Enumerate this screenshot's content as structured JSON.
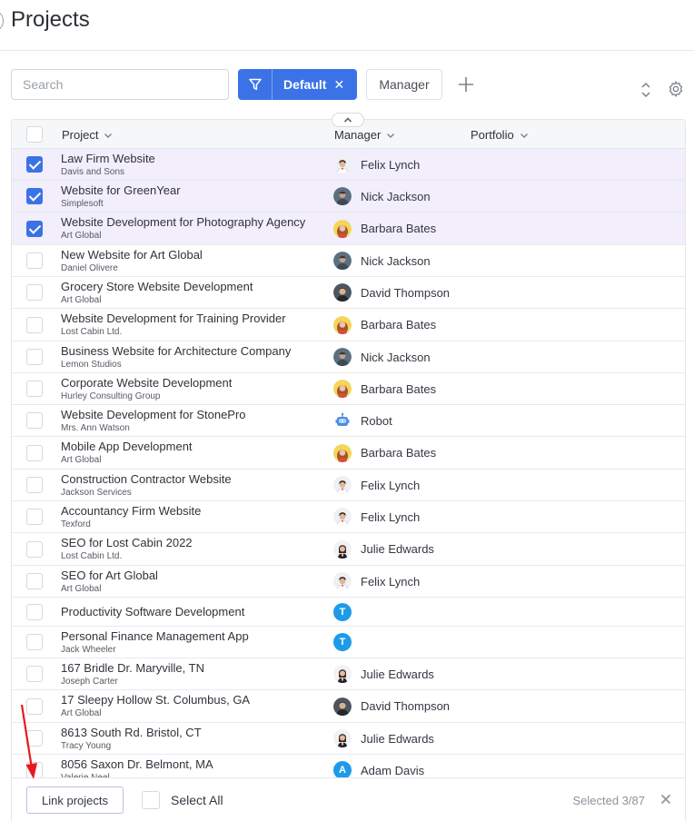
{
  "page": {
    "title": "Projects"
  },
  "toolbar": {
    "search_placeholder": "Search",
    "filter_label": "Default",
    "filter_close": "✕",
    "manager_label": "Manager",
    "add_icon": "plus-icon",
    "sort_icon": "sort-updown-icon",
    "settings_icon": "gear-icon"
  },
  "table": {
    "columns": {
      "project": "Project",
      "manager": "Manager",
      "portfolio": "Portfolio"
    },
    "rows": [
      {
        "name": "Law Firm Website",
        "client": "Davis and Sons",
        "manager": "Felix Lynch",
        "avatar": "felix",
        "checked": true
      },
      {
        "name": "Website for GreenYear",
        "client": "Simplesoft",
        "manager": "Nick Jackson",
        "avatar": "nick",
        "checked": true
      },
      {
        "name": "Website Development for Photography Agency",
        "client": "Art Global",
        "manager": "Barbara Bates",
        "avatar": "barbara",
        "checked": true
      },
      {
        "name": "New Website for Art Global",
        "client": "Daniel Olivere",
        "manager": "Nick Jackson",
        "avatar": "nick",
        "checked": false
      },
      {
        "name": "Grocery Store Website Development",
        "client": "Art Global",
        "manager": "David Thompson",
        "avatar": "david",
        "checked": false
      },
      {
        "name": "Website Development for Training Provider",
        "client": "Lost Cabin Ltd.",
        "manager": "Barbara Bates",
        "avatar": "barbara",
        "checked": false
      },
      {
        "name": "Business Website for Architecture Company",
        "client": "Lemon Studios",
        "manager": "Nick Jackson",
        "avatar": "nick",
        "checked": false
      },
      {
        "name": "Corporate Website Development",
        "client": "Hurley Consulting Group",
        "manager": "Barbara Bates",
        "avatar": "barbara",
        "checked": false
      },
      {
        "name": "Website Development for StonePro",
        "client": "Mrs. Ann Watson",
        "manager": "Robot",
        "avatar": "robot",
        "checked": false
      },
      {
        "name": "Mobile App Development",
        "client": "Art Global",
        "manager": "Barbara Bates",
        "avatar": "barbara",
        "checked": false
      },
      {
        "name": "Construction Contractor Website",
        "client": "Jackson Services",
        "manager": "Felix Lynch",
        "avatar": "felix",
        "checked": false
      },
      {
        "name": "Accountancy Firm Website",
        "client": "Texford",
        "manager": "Felix Lynch",
        "avatar": "felix",
        "checked": false
      },
      {
        "name": "SEO for Lost Cabin 2022",
        "client": "Lost Cabin Ltd.",
        "manager": "Julie Edwards",
        "avatar": "julie",
        "checked": false
      },
      {
        "name": "SEO for Art Global",
        "client": "Art Global",
        "manager": "Felix Lynch",
        "avatar": "felix",
        "checked": false
      },
      {
        "name": "Productivity Software Development",
        "client": "",
        "manager": "",
        "avatar": "T",
        "checked": false
      },
      {
        "name": "Personal Finance Management App",
        "client": "Jack Wheeler",
        "manager": "",
        "avatar": "T",
        "checked": false
      },
      {
        "name": "167 Bridle Dr. Maryville, TN",
        "client": "Joseph Carter",
        "manager": "Julie Edwards",
        "avatar": "julie",
        "checked": false
      },
      {
        "name": "17 Sleepy Hollow St. Columbus, GA",
        "client": "Art Global",
        "manager": "David Thompson",
        "avatar": "david",
        "checked": false
      },
      {
        "name": "8613 South Rd. Bristol, CT",
        "client": "Tracy Young",
        "manager": "Julie Edwards",
        "avatar": "julie",
        "checked": false
      },
      {
        "name": "8056 Saxon Dr. Belmont, MA",
        "client": "Valerie Neel",
        "manager": "Adam Davis",
        "avatar": "A",
        "checked": false
      }
    ]
  },
  "bottom_bar": {
    "link_button": "Link projects",
    "select_all": "Select All",
    "selected_count": "Selected 3/87",
    "close_icon": "close-icon"
  },
  "colors": {
    "accent": "#3b73e6",
    "selected_row": "#f2eefb",
    "letter_avatar": "#1e9be8",
    "annotation_arrow": "#e8191c"
  }
}
